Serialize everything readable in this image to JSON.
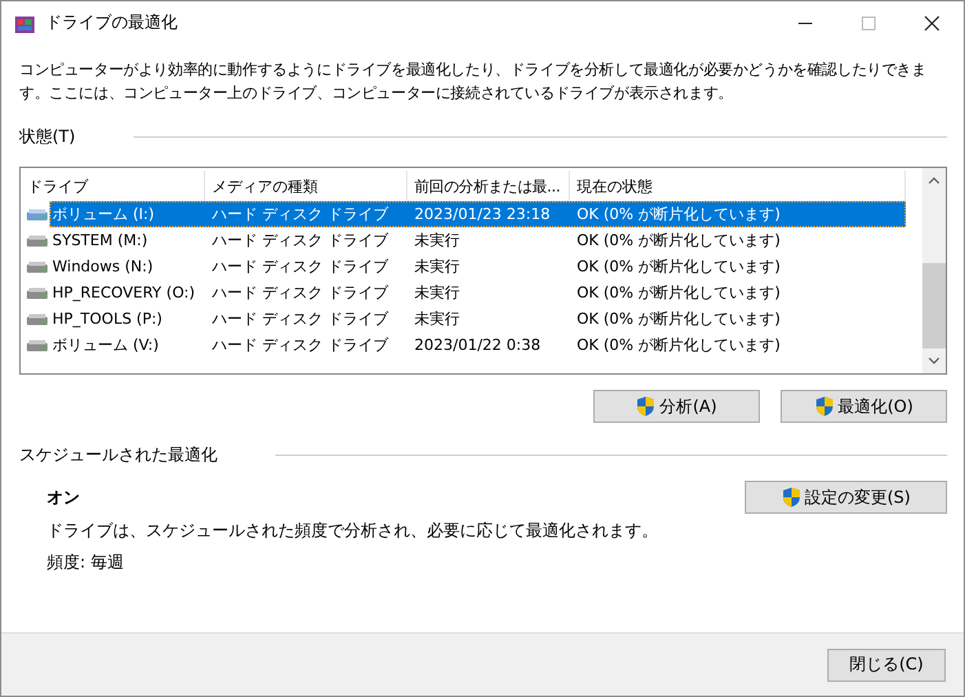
{
  "window": {
    "title": "ドライブの最適化"
  },
  "description": "コンピューターがより効率的に動作するようにドライブを最適化したり、ドライブを分析して最適化が必要かどうかを確認したりできます。ここには、コンピューター上のドライブ、コンピューターに接続されているドライブが表示されます。",
  "status_section": {
    "heading": "状態(T)"
  },
  "table": {
    "columns": [
      "ドライブ",
      "メディアの種類",
      "前回の分析または最...",
      "現在の状態"
    ],
    "rows": [
      {
        "selected": true,
        "cells": [
          "ボリューム (I:)",
          "ハード ディスク ドライブ",
          "2023/01/23 23:18",
          "OK (0% が断片化しています)"
        ]
      },
      {
        "selected": false,
        "cells": [
          "SYSTEM  (M:)",
          "ハード ディスク ドライブ",
          "未実行",
          "OK (0% が断片化しています)"
        ]
      },
      {
        "selected": false,
        "cells": [
          "Windows (N:)",
          "ハード ディスク ドライブ",
          "未実行",
          "OK (0% が断片化しています)"
        ]
      },
      {
        "selected": false,
        "cells": [
          "HP_RECOVERY (O:)",
          "ハード ディスク ドライブ",
          "未実行",
          "OK (0% が断片化しています)"
        ]
      },
      {
        "selected": false,
        "cells": [
          "HP_TOOLS (P:)",
          "ハード ディスク ドライブ",
          "未実行",
          "OK (0% が断片化しています)"
        ]
      },
      {
        "selected": false,
        "cells": [
          "ボリューム (V:)",
          "ハード ディスク ドライブ",
          "2023/01/22 0:38",
          "OK (0% が断片化しています)"
        ]
      }
    ]
  },
  "actions": [
    "分析(A)",
    "最適化(O)"
  ],
  "schedule": {
    "heading": "スケジュールされた最適化",
    "state": "オン",
    "description": "ドライブは、スケジュールされた頻度で分析され、必要に応じて最適化されます。",
    "frequency": "頻度: 毎週",
    "button": "設定の変更(S)"
  },
  "footer": {
    "button": "閉じる(C)"
  }
}
